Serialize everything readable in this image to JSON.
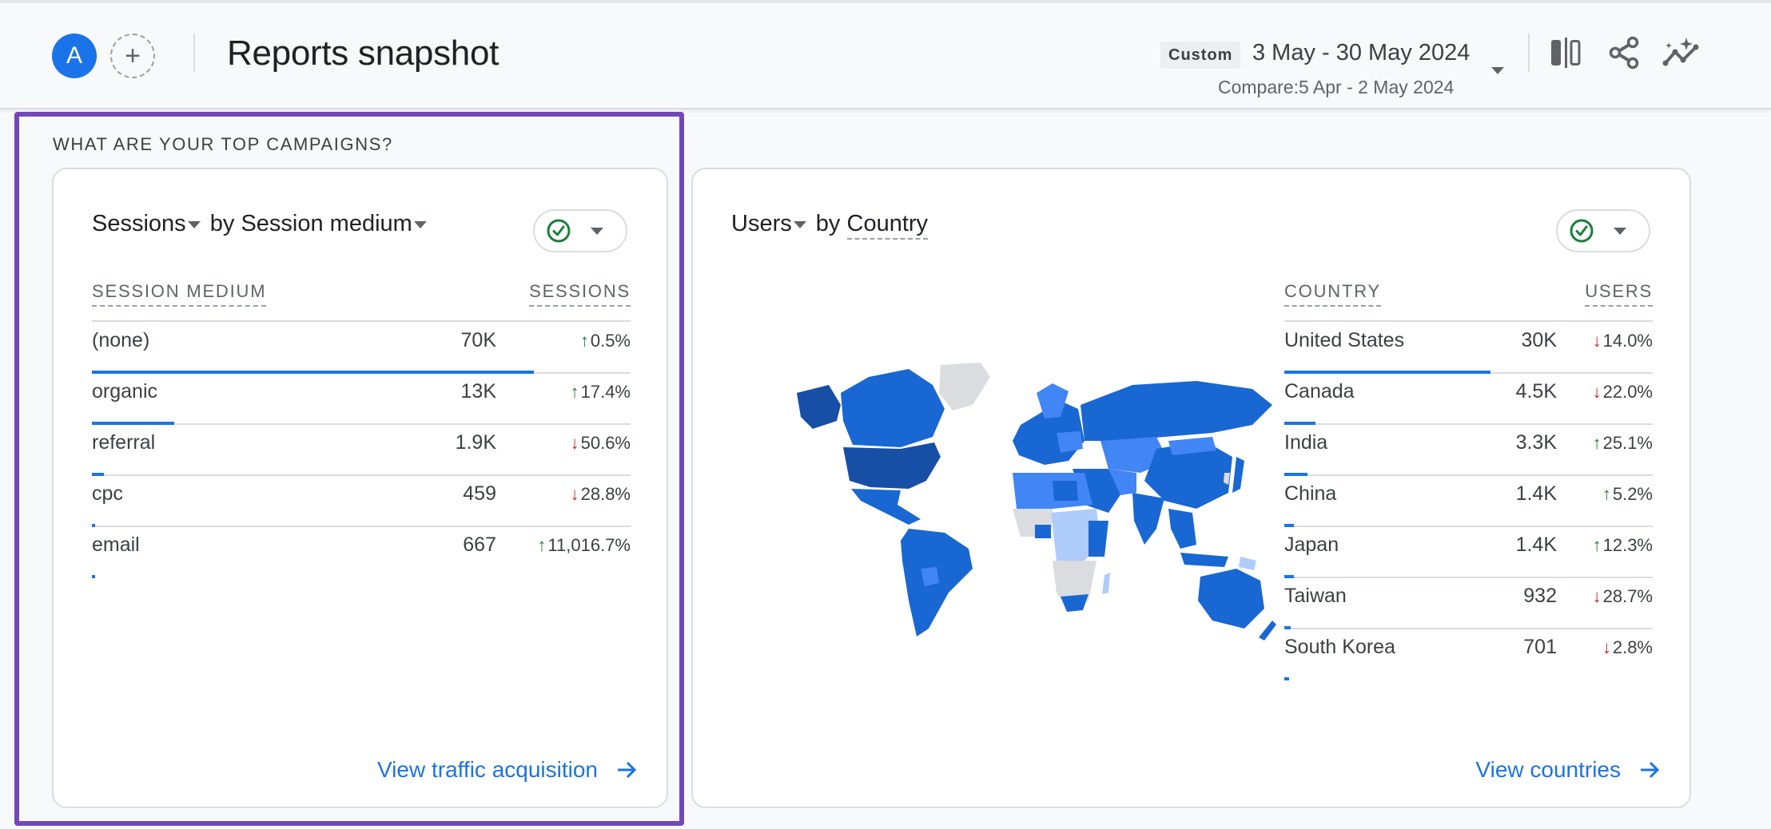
{
  "header": {
    "avatar_letter": "A",
    "add_comparison_symbol": "+",
    "title": "Reports snapshot",
    "date_chip": "Custom",
    "date_range": "3 May - 30 May 2024",
    "compare_range": "Compare:5 Apr - 2 May 2024",
    "icons": [
      "compare-columns-icon",
      "share-icon",
      "insights-icon"
    ]
  },
  "section": {
    "title": "WHAT ARE YOUR TOP CAMPAIGNS?"
  },
  "left_card": {
    "metric": "Sessions",
    "by": "by",
    "dimension": "Session medium",
    "status": "check-circle-icon",
    "columns": [
      "SESSION MEDIUM",
      "SESSIONS"
    ],
    "rows": [
      {
        "name": "(none)",
        "value": "70K",
        "direction": "up",
        "change": "0.5%",
        "share": 0.82
      },
      {
        "name": "organic",
        "value": "13K",
        "direction": "up",
        "change": "17.4%",
        "share": 0.153
      },
      {
        "name": "referral",
        "value": "1.9K",
        "direction": "down",
        "change": "50.6%",
        "share": 0.022
      },
      {
        "name": "cpc",
        "value": "459",
        "direction": "down",
        "change": "28.8%",
        "share": 0.006
      },
      {
        "name": "email",
        "value": "667",
        "direction": "up",
        "change": "11,016.7%",
        "share": 0.006
      }
    ],
    "link": "View traffic acquisition"
  },
  "right_card": {
    "metric": "Users",
    "by": "by",
    "dimension": "Country",
    "status": "check-circle-icon",
    "columns": [
      "COUNTRY",
      "USERS"
    ],
    "rows": [
      {
        "name": "United States",
        "value": "30K",
        "direction": "down",
        "change": "14.0%",
        "share": 0.56
      },
      {
        "name": "Canada",
        "value": "4.5K",
        "direction": "down",
        "change": "22.0%",
        "share": 0.085
      },
      {
        "name": "India",
        "value": "3.3K",
        "direction": "up",
        "change": "25.1%",
        "share": 0.062
      },
      {
        "name": "China",
        "value": "1.4K",
        "direction": "up",
        "change": "5.2%",
        "share": 0.027
      },
      {
        "name": "Japan",
        "value": "1.4K",
        "direction": "up",
        "change": "12.3%",
        "share": 0.027
      },
      {
        "name": "Taiwan",
        "value": "932",
        "direction": "down",
        "change": "28.7%",
        "share": 0.018
      },
      {
        "name": "South Korea",
        "value": "701",
        "direction": "down",
        "change": "2.8%",
        "share": 0.013
      }
    ],
    "map": {
      "type": "choropleth-world",
      "colors": {
        "highest": "#174ea6",
        "high": "#1967d2",
        "medium": "#4285f4",
        "low": "#aecbfa",
        "none": "#dadce0"
      }
    },
    "link": "View countries"
  },
  "colors": {
    "accent": "#1a73e8",
    "up": "#188038",
    "down": "#c5221f",
    "highlight_border": "#7248b9"
  }
}
